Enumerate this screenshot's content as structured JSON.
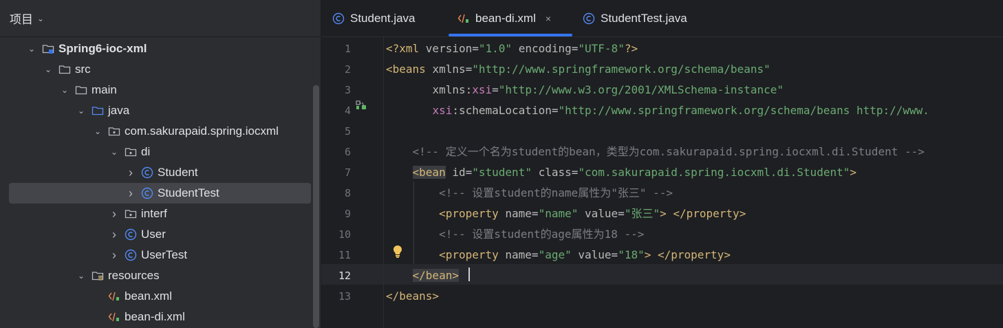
{
  "project_panel": {
    "title": "项目",
    "tree": [
      {
        "label": "Spring6-ioc-xml",
        "kind": "module",
        "depth": 0,
        "expanded": true,
        "bold": true
      },
      {
        "label": "src",
        "kind": "folder",
        "depth": 1,
        "expanded": true
      },
      {
        "label": "main",
        "kind": "folder",
        "depth": 2,
        "expanded": true
      },
      {
        "label": "java",
        "kind": "source-folder",
        "depth": 3,
        "expanded": true
      },
      {
        "label": "com.sakurapaid.spring.iocxml",
        "kind": "package",
        "depth": 4,
        "expanded": true
      },
      {
        "label": "di",
        "kind": "package",
        "depth": 5,
        "expanded": true
      },
      {
        "label": "Student",
        "kind": "class",
        "depth": 6,
        "expanded": false
      },
      {
        "label": "StudentTest",
        "kind": "class",
        "depth": 6,
        "expanded": false,
        "selected": true
      },
      {
        "label": "interf",
        "kind": "package",
        "depth": 5,
        "expanded": false
      },
      {
        "label": "User",
        "kind": "class",
        "depth": 5,
        "expanded": false
      },
      {
        "label": "UserTest",
        "kind": "class",
        "depth": 5,
        "expanded": false
      },
      {
        "label": "resources",
        "kind": "resources-folder",
        "depth": 3,
        "expanded": true
      },
      {
        "label": "bean.xml",
        "kind": "xml",
        "depth": 4,
        "leaf": true
      },
      {
        "label": "bean-di.xml",
        "kind": "xml",
        "depth": 4,
        "leaf": true
      }
    ]
  },
  "tabs": [
    {
      "label": "Student.java",
      "kind": "class"
    },
    {
      "label": "bean-di.xml",
      "kind": "xml",
      "active": true,
      "close": "×"
    },
    {
      "label": "StudentTest.java",
      "kind": "class"
    }
  ],
  "editor": {
    "current_line": 12,
    "lines": [
      {
        "n": "1",
        "tokens": [
          [
            "pi",
            "<?"
          ],
          [
            "tag",
            "xml "
          ],
          [
            "attr",
            "version"
          ],
          [
            "p",
            "="
          ],
          [
            "val",
            "\"1.0\""
          ],
          [
            "p",
            " "
          ],
          [
            "attr",
            "encoding"
          ],
          [
            "p",
            "="
          ],
          [
            "val",
            "\"UTF-8\""
          ],
          [
            "pi",
            "?>"
          ]
        ]
      },
      {
        "n": "2",
        "tokens": [
          [
            "tag",
            "<beans "
          ],
          [
            "attr",
            "xmlns"
          ],
          [
            "p",
            "="
          ],
          [
            "val",
            "\"http://www.springframework.org/schema/beans\""
          ]
        ]
      },
      {
        "n": "3",
        "tokens": [
          [
            "p",
            "       "
          ],
          [
            "attr",
            "xmlns:"
          ],
          [
            "ns",
            "xsi"
          ],
          [
            "p",
            "="
          ],
          [
            "val",
            "\"http://www.w3.org/2001/XMLSchema-instance\""
          ]
        ]
      },
      {
        "n": "4",
        "tokens": [
          [
            "p",
            "       "
          ],
          [
            "ns",
            "xsi"
          ],
          [
            "attr",
            ":schemaLocation"
          ],
          [
            "p",
            "="
          ],
          [
            "val",
            "\"http://www.springframework.org/schema/beans http://www."
          ]
        ]
      },
      {
        "n": "5",
        "tokens": []
      },
      {
        "n": "6",
        "tokens": [
          [
            "p",
            "    "
          ],
          [
            "com",
            "<!-- 定义一个名为student的bean，类型为com.sakurapaid.spring.iocxml.di.Student -->"
          ]
        ]
      },
      {
        "n": "7",
        "tokens": [
          [
            "p",
            "    "
          ],
          [
            "taghl",
            "<bean"
          ],
          [
            "p",
            " "
          ],
          [
            "attr",
            "id"
          ],
          [
            "p",
            "="
          ],
          [
            "val",
            "\"student\""
          ],
          [
            "p",
            " "
          ],
          [
            "attr",
            "class"
          ],
          [
            "p",
            "="
          ],
          [
            "val",
            "\"com.sakurapaid.spring.iocxml.di.Student\""
          ],
          [
            "tag",
            ">"
          ]
        ]
      },
      {
        "n": "8",
        "tokens": [
          [
            "p",
            "        "
          ],
          [
            "com",
            "<!-- 设置student的name属性为\"张三\" -->"
          ]
        ]
      },
      {
        "n": "9",
        "tokens": [
          [
            "p",
            "        "
          ],
          [
            "tag",
            "<property "
          ],
          [
            "attr",
            "name"
          ],
          [
            "p",
            "="
          ],
          [
            "val",
            "\"name\""
          ],
          [
            "p",
            " "
          ],
          [
            "attr",
            "value"
          ],
          [
            "p",
            "="
          ],
          [
            "val",
            "\"张三\""
          ],
          [
            "tag",
            "> </property>"
          ]
        ]
      },
      {
        "n": "10",
        "tokens": [
          [
            "p",
            "        "
          ],
          [
            "com",
            "<!-- 设置student的age属性为18 -->"
          ]
        ]
      },
      {
        "n": "11",
        "tokens": [
          [
            "p",
            "        "
          ],
          [
            "tag",
            "<property "
          ],
          [
            "attr",
            "name"
          ],
          [
            "p",
            "="
          ],
          [
            "val",
            "\"age\""
          ],
          [
            "p",
            " "
          ],
          [
            "attr",
            "value"
          ],
          [
            "p",
            "="
          ],
          [
            "val",
            "\"18\""
          ],
          [
            "tag",
            "> </property>"
          ]
        ]
      },
      {
        "n": "12",
        "tokens": [
          [
            "p",
            "    "
          ],
          [
            "taghl",
            "</bean>"
          ]
        ]
      },
      {
        "n": "13",
        "tokens": [
          [
            "tag",
            "</beans>"
          ]
        ]
      }
    ]
  },
  "icons": {
    "chevron": "chevron-down-icon",
    "bulb": "lightbulb-icon"
  },
  "colors": {
    "accent": "#3574f0",
    "class_icon": "#548af7",
    "xml_icon": "#e08855"
  }
}
